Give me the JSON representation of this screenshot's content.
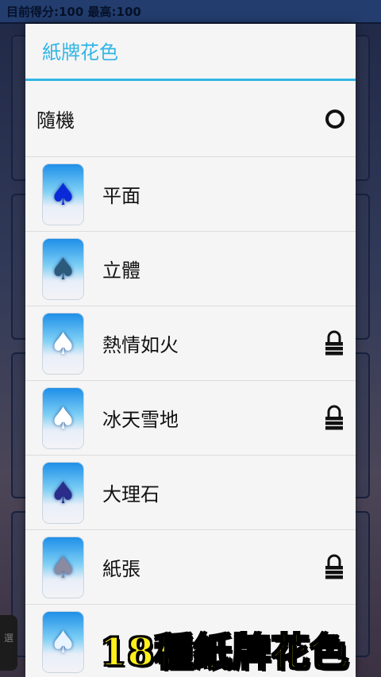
{
  "topbar": {
    "score_label": "目前得分:",
    "score": "100",
    "best_label": "最高:",
    "best": "100"
  },
  "side_button": "選",
  "dialog": {
    "title": "紙牌花色",
    "random_label": "隨機",
    "items": [
      {
        "label": "平面",
        "locked": false,
        "spade_color": "#0a2ad8"
      },
      {
        "label": "立體",
        "locked": false,
        "spade_color": "#2b5a7a"
      },
      {
        "label": "熱情如火",
        "locked": true,
        "spade_color": "#ffffff"
      },
      {
        "label": "冰天雪地",
        "locked": true,
        "spade_color": "#ffffff"
      },
      {
        "label": "大理石",
        "locked": false,
        "spade_color": "#2a2e8a"
      },
      {
        "label": "紙張",
        "locked": true,
        "spade_color": "#8a8aa0"
      },
      {
        "label": "",
        "locked": false,
        "spade_color": "#e8f4ff"
      }
    ]
  },
  "promo_text": "18種紙牌花色",
  "colors": {
    "accent": "#33b5e5",
    "promo_yellow": "#ffef1a"
  }
}
